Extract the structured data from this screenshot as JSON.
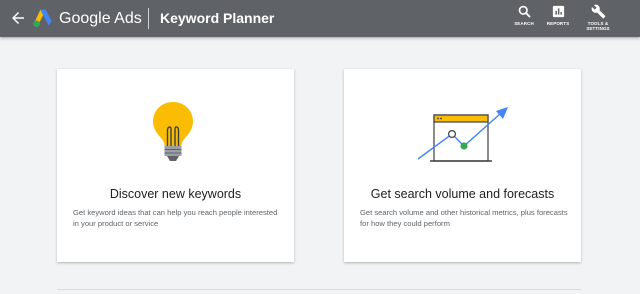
{
  "header": {
    "product_name": "Google Ads",
    "tool_title": "Keyword Planner",
    "actions": [
      {
        "label": "SEARCH",
        "icon": "search-icon"
      },
      {
        "label": "REPORTS",
        "icon": "reports-icon"
      },
      {
        "label": "TOOLS &",
        "label2": "SETTINGS",
        "icon": "wrench-icon"
      }
    ]
  },
  "cards": [
    {
      "title": "Discover new keywords",
      "description": "Get keyword ideas that can help you reach people interested in your product or service",
      "icon": "lightbulb-icon"
    },
    {
      "title": "Get search volume and forecasts",
      "description": "Get search volume and other historical metrics, plus forecasts for how they could perform",
      "icon": "forecast-chart-icon"
    }
  ],
  "colors": {
    "topbar": "#5f6368",
    "background": "#f1f3f4",
    "bulb_yellow": "#fbbc04",
    "trend_blue": "#4285f4",
    "point_green": "#34a853"
  }
}
